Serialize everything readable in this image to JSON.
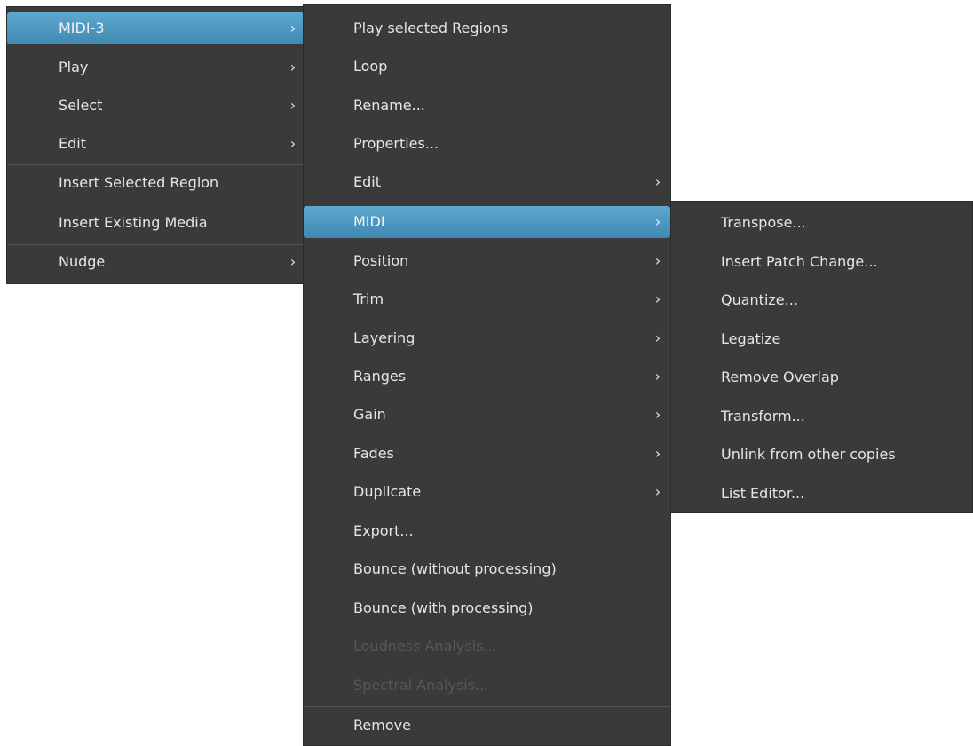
{
  "menu_level1": {
    "items": [
      {
        "label": "MIDI-3",
        "arrow": "›"
      },
      {
        "label": "Play",
        "arrow": "›"
      },
      {
        "label": "Select",
        "arrow": "›"
      },
      {
        "label": "Edit",
        "arrow": "›"
      },
      {
        "label": "Insert Selected Region"
      },
      {
        "label": "Insert Existing Media"
      },
      {
        "label": "Nudge",
        "arrow": "›"
      }
    ]
  },
  "menu_level2": {
    "items": [
      {
        "label": "Play selected Regions"
      },
      {
        "label": "Loop"
      },
      {
        "label": "Rename..."
      },
      {
        "label": "Properties..."
      },
      {
        "label": "Edit",
        "arrow": "›"
      },
      {
        "label": "MIDI",
        "arrow": "›"
      },
      {
        "label": "Position",
        "arrow": "›"
      },
      {
        "label": "Trim",
        "arrow": "›"
      },
      {
        "label": "Layering",
        "arrow": "›"
      },
      {
        "label": "Ranges",
        "arrow": "›"
      },
      {
        "label": "Gain",
        "arrow": "›"
      },
      {
        "label": "Fades",
        "arrow": "›"
      },
      {
        "label": "Duplicate",
        "arrow": "›"
      },
      {
        "label": "Export..."
      },
      {
        "label": "Bounce (without processing)"
      },
      {
        "label": "Bounce (with processing)"
      },
      {
        "label": "Loudness Analysis..."
      },
      {
        "label": "Spectral Analysis..."
      },
      {
        "label": "Remove"
      }
    ]
  },
  "menu_level3": {
    "items": [
      {
        "label": "Transpose..."
      },
      {
        "label": "Insert Patch Change..."
      },
      {
        "label": "Quantize..."
      },
      {
        "label": "Legatize"
      },
      {
        "label": "Remove Overlap"
      },
      {
        "label": "Transform..."
      },
      {
        "label": "Unlink from other copies"
      },
      {
        "label": "List Editor..."
      }
    ]
  },
  "colors": {
    "menu_background": "#3a3a3a",
    "highlight": "#4a98c4",
    "text": "#e6e6e6",
    "disabled_text": "#575757",
    "separator": "#545454"
  }
}
